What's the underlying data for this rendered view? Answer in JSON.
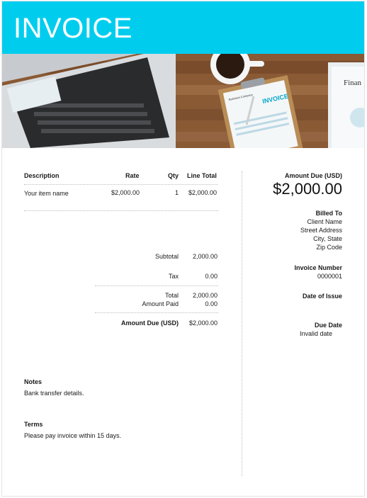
{
  "header": {
    "title": "INVOICE"
  },
  "table": {
    "columns": [
      "Description",
      "Rate",
      "Qty",
      "Line Total"
    ],
    "rows": [
      {
        "description": "Your item name",
        "rate": "$2,000.00",
        "qty": "1",
        "line_total": "$2,000.00"
      }
    ]
  },
  "totals": {
    "subtotal_label": "Subtotal",
    "subtotal": "2,000.00",
    "tax_label": "Tax",
    "tax": "0.00",
    "total_label": "Total",
    "total": "2,000.00",
    "paid_label": "Amount Paid",
    "paid": "0.00",
    "due_label": "Amount Due (USD)",
    "due": "$2,000.00"
  },
  "notes": {
    "label": "Notes",
    "text": "Bank transfer details."
  },
  "terms": {
    "label": "Terms",
    "text": "Please pay invoice within 15 days."
  },
  "sidebar": {
    "amount_due_label": "Amount Due (USD)",
    "amount_due": "$2,000.00",
    "billed_to_label": "Billed To",
    "billed_to_lines": [
      "Client Name",
      "Street Address",
      "City, State",
      "Zip Code"
    ],
    "invoice_number_label": "Invoice Number",
    "invoice_number": "0000001",
    "date_of_issue_label": "Date of Issue",
    "due_date_label": "Due Date",
    "due_date": "Invalid date"
  },
  "photo": {
    "finance_doc_text": "Finan",
    "clipboard_heading": "INVOICE",
    "clipboard_company": "Business Company"
  },
  "colors": {
    "accent": "#00cdee",
    "label": "#00bfe6"
  }
}
